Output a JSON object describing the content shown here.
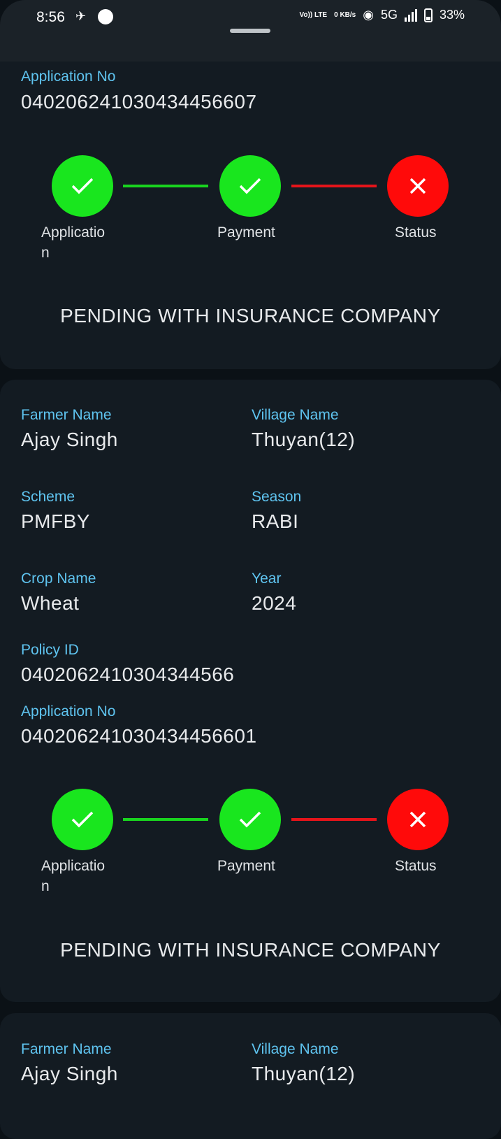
{
  "status_bar": {
    "time": "8:56",
    "network_labels": [
      "Vo)) LTE",
      "0 KB/s",
      "5G"
    ],
    "battery": "33%"
  },
  "card1": {
    "application_no_label": "Application No",
    "application_no": "04020624103043445660 7",
    "steps": [
      {
        "label": "Applicatio\nn",
        "state": "done",
        "icon": "check-icon"
      },
      {
        "label": "Payment",
        "state": "done",
        "icon": "check-icon"
      },
      {
        "label": "Status",
        "state": "failed",
        "icon": "close-icon"
      }
    ],
    "status": "PENDING WITH INSURANCE COMPANY"
  },
  "card2": {
    "farmer_name_label": "Farmer Name",
    "farmer_name": "Ajay Singh",
    "village_name_label": "Village Name",
    "village_name": "Thuyan(12)",
    "scheme_label": "Scheme",
    "scheme": "PMFBY",
    "season_label": "Season",
    "season": "RABI",
    "crop_name_label": "Crop Name",
    "crop_name": "Wheat",
    "year_label": "Year",
    "year": "2024",
    "policy_id_label": "Policy ID",
    "policy_id": "0402062410304344566",
    "application_no_label": "Application No",
    "application_no": "040206241030434456601",
    "steps": [
      {
        "label": "Applicatio\nn",
        "state": "done",
        "icon": "check-icon"
      },
      {
        "label": "Payment",
        "state": "done",
        "icon": "check-icon"
      },
      {
        "label": "Status",
        "state": "failed",
        "icon": "close-icon"
      }
    ],
    "status": "PENDING WITH INSURANCE COMPANY"
  },
  "card3": {
    "farmer_name_label": "Farmer Name",
    "farmer_name": "Ajay Singh",
    "village_name_label": "Village Name",
    "village_name": "Thuyan(12)"
  },
  "colors": {
    "background": "#0b1116",
    "card": "#131b22",
    "label": "#5fc4f0",
    "done": "#19e61e",
    "failed": "#ff0a0a"
  }
}
